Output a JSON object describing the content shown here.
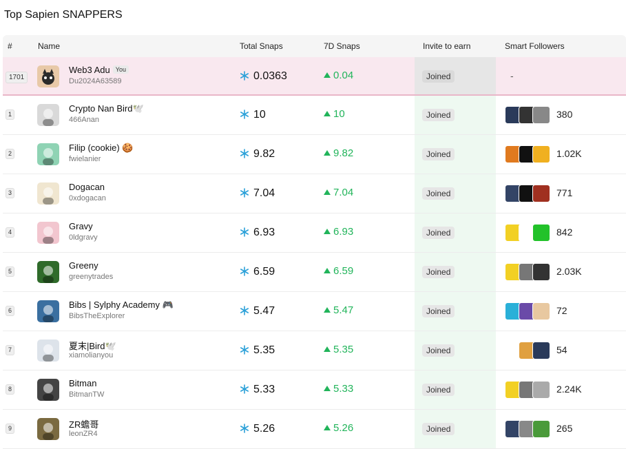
{
  "title": "Top Sapien SNAPPERS",
  "columns": {
    "rank": "#",
    "name": "Name",
    "total": "Total Snaps",
    "d7": "7D Snaps",
    "invite": "Invite to earn",
    "followers": "Smart Followers"
  },
  "me": {
    "rank": "1701",
    "name": "Web3 Adu",
    "badge": "You",
    "handle": "Du2024A63589",
    "total": "0.0363",
    "d7": "0.04",
    "invite": "Joined",
    "followers": "-",
    "avatar_color": "#e8c9a8"
  },
  "rows": [
    {
      "rank": "1",
      "name": "Crypto Nan Bird🕊️",
      "handle": "466Anan",
      "total": "10",
      "d7": "10",
      "invite": "Joined",
      "count": "380",
      "avatar_color": "#d9d9d9",
      "f": [
        "#2a3a5a",
        "#333333",
        "#888888"
      ]
    },
    {
      "rank": "2",
      "name": "Filip (cookie) 🍪",
      "handle": "fwielanier",
      "total": "9.82",
      "d7": "9.82",
      "invite": "Joined",
      "count": "1.02K",
      "avatar_color": "#8fd3b4",
      "f": [
        "#e07a1f",
        "#111111",
        "#f0b020"
      ]
    },
    {
      "rank": "3",
      "name": "Dogacan",
      "handle": "0xdogacan",
      "total": "7.04",
      "d7": "7.04",
      "invite": "Joined",
      "count": "771",
      "avatar_color": "#f0e6d0",
      "f": [
        "#334466",
        "#111111",
        "#a03020"
      ]
    },
    {
      "rank": "4",
      "name": "Gravy",
      "handle": "0ldgravy",
      "total": "6.93",
      "d7": "6.93",
      "invite": "Joined",
      "count": "842",
      "avatar_color": "#f2c6cf",
      "f": [
        "#f2d024",
        "#ffffff",
        "#22c22a"
      ]
    },
    {
      "rank": "5",
      "name": "Greeny",
      "handle": "greenytrades",
      "total": "6.59",
      "d7": "6.59",
      "invite": "Joined",
      "count": "2.03K",
      "avatar_color": "#2f6b2a",
      "f": [
        "#f2d024",
        "#777777",
        "#333333"
      ]
    },
    {
      "rank": "6",
      "name": "Bibs | Sylphy Academy 🎮",
      "handle": "BibsTheExplorer",
      "total": "5.47",
      "d7": "5.47",
      "invite": "Joined",
      "count": "72",
      "avatar_color": "#3a6fa0",
      "f": [
        "#2ab0d8",
        "#6a4aa8",
        "#e8c8a0"
      ]
    },
    {
      "rank": "7",
      "name": "夏末|Bird🕊️",
      "handle": "xiamolianyou",
      "total": "5.35",
      "d7": "5.35",
      "invite": "Joined",
      "count": "54",
      "avatar_color": "#dde3ea",
      "f": [
        "#ffffff",
        "#e0a040",
        "#2a3a5a"
      ]
    },
    {
      "rank": "8",
      "name": "Bitman",
      "handle": "BitmanTW",
      "total": "5.33",
      "d7": "5.33",
      "invite": "Joined",
      "count": "2.24K",
      "avatar_color": "#444444",
      "f": [
        "#f2d024",
        "#777777",
        "#aaaaaa"
      ]
    },
    {
      "rank": "9",
      "name": "ZR蟾哥",
      "handle": "leonZR4",
      "total": "5.26",
      "d7": "5.26",
      "invite": "Joined",
      "count": "265",
      "avatar_color": "#7a6a40",
      "f": [
        "#334466",
        "#888888",
        "#4a9a3a"
      ]
    }
  ]
}
